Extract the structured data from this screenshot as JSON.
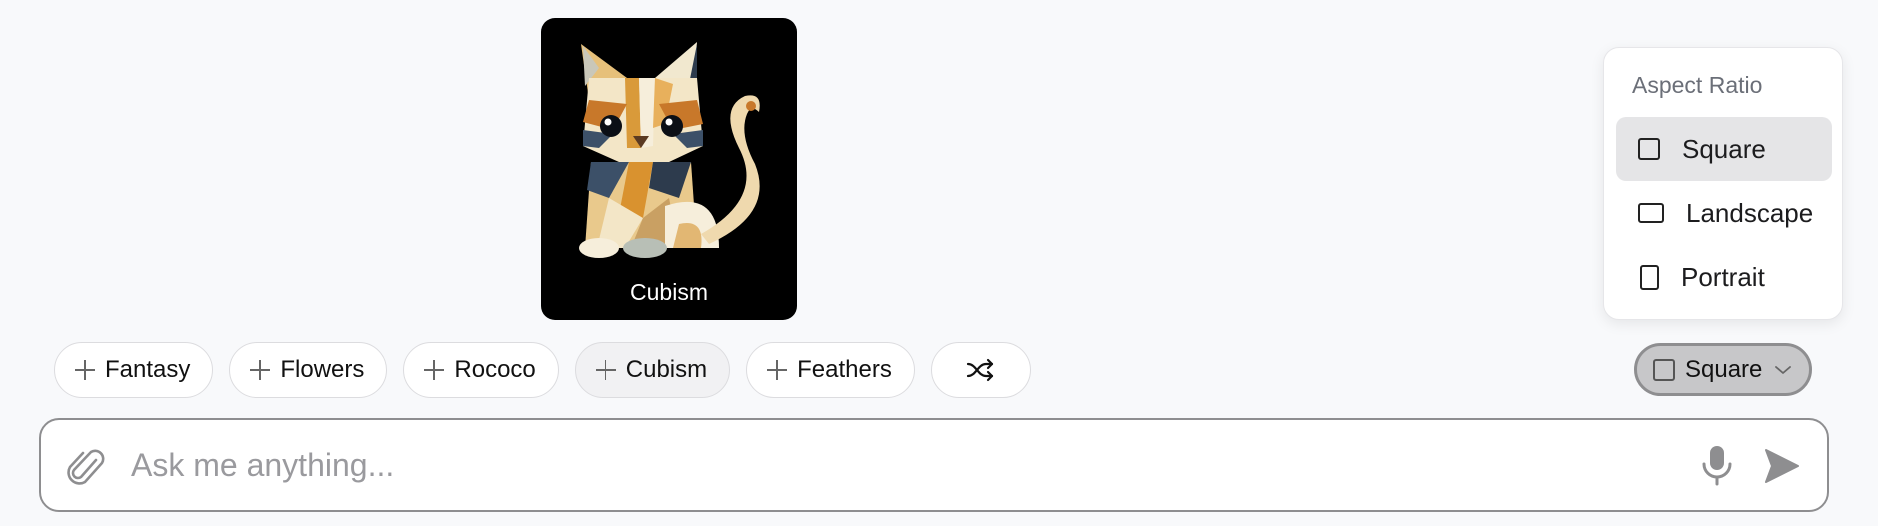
{
  "preview": {
    "caption": "Cubism",
    "image_subject": "cubist-cat-illustration"
  },
  "chips": [
    {
      "label": "Fantasy",
      "icon": "plus-icon",
      "active": false
    },
    {
      "label": "Flowers",
      "icon": "plus-icon",
      "active": false
    },
    {
      "label": "Rococo",
      "icon": "plus-icon",
      "active": false
    },
    {
      "label": "Cubism",
      "icon": "plus-icon",
      "active": true
    },
    {
      "label": "Feathers",
      "icon": "plus-icon",
      "active": false
    }
  ],
  "shuffle": {
    "icon": "shuffle-icon"
  },
  "aspect_menu": {
    "title": "Aspect Ratio",
    "items": [
      {
        "label": "Square",
        "icon": "square-icon",
        "selected": true
      },
      {
        "label": "Landscape",
        "icon": "landscape-icon",
        "selected": false
      },
      {
        "label": "Portrait",
        "icon": "portrait-icon",
        "selected": false
      }
    ]
  },
  "aspect_button": {
    "label": "Square",
    "icon": "square-icon",
    "chevron": "chevron-down-icon"
  },
  "input": {
    "placeholder": "Ask me anything...",
    "value": "",
    "attach_icon": "paperclip-icon",
    "mic_icon": "microphone-icon",
    "send_icon": "send-icon"
  },
  "colors": {
    "background": "#f8f9fb",
    "chip_border": "#dcdcdf",
    "chip_active_bg": "#f1f1f3",
    "menu_selected_bg": "#e5e5e7",
    "aspect_button_bg": "#c7c7c9",
    "icon_gray": "#8e8e90"
  }
}
